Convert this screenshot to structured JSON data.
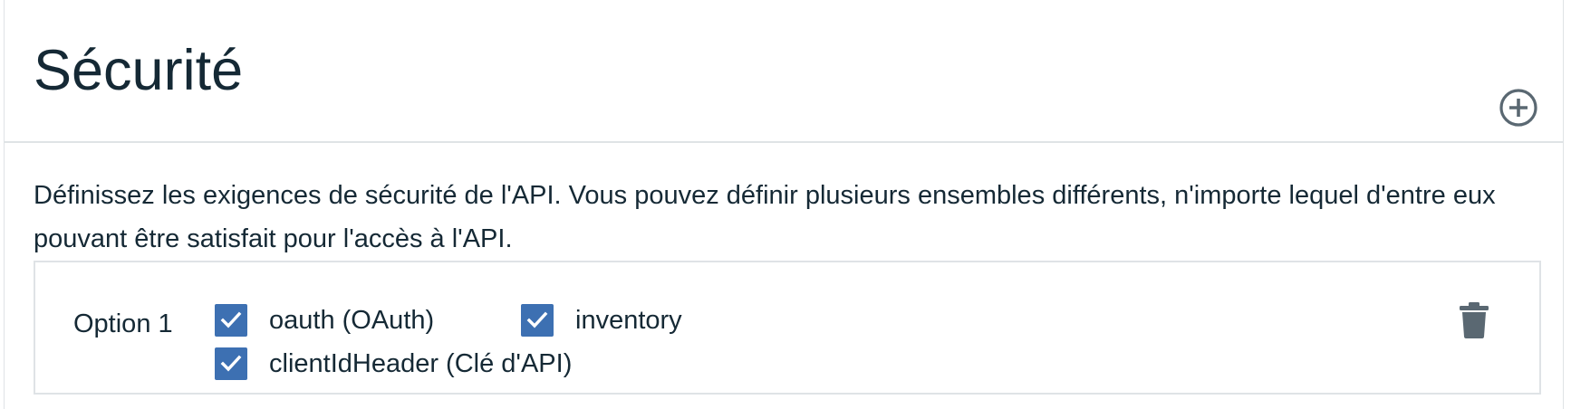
{
  "section": {
    "title": "Sécurité",
    "description": "Définissez les exigences de sécurité de l'API. Vous pouvez définir plusieurs ensembles différents, n'importe lequel d'entre eux pouvant être satisfait pour l'accès à l'API."
  },
  "options": [
    {
      "label": "Option 1",
      "schemes": [
        {
          "label": "oauth (OAuth)",
          "checked": true
        },
        {
          "label": "inventory",
          "checked": true
        },
        {
          "label": "clientIdHeader (Clé d'API)",
          "checked": true
        }
      ]
    }
  ],
  "icons": {
    "add": "add-circle-icon",
    "delete": "trash-icon",
    "check": "checkmark-icon"
  },
  "colors": {
    "checkbox_fill": "#3d70b2",
    "text": "#152935",
    "icon": "#5a6872",
    "border": "#dfe3e6"
  }
}
